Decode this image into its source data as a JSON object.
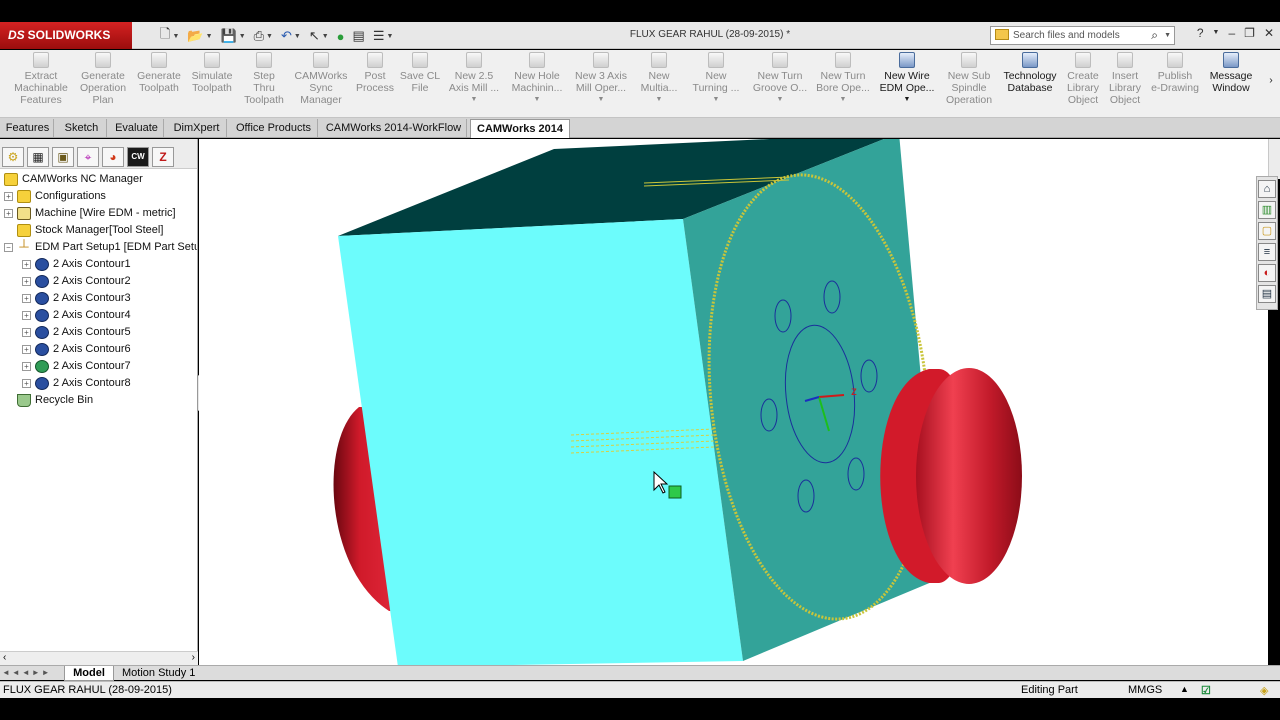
{
  "app": {
    "name": "SOLIDWORKS",
    "brand": "DS",
    "brand_color": "#c21a1a"
  },
  "document_title": "FLUX GEAR RAHUL (28-09-2015) *",
  "search": {
    "placeholder": "Search files and models"
  },
  "commands": [
    {
      "label_1": "Extract",
      "label_2": "Machinable",
      "label_3": "Features",
      "enabled": false
    },
    {
      "label_1": "Generate",
      "label_2": "Operation",
      "label_3": "Plan",
      "enabled": false
    },
    {
      "label_1": "Generate",
      "label_2": "Toolpath",
      "label_3": "",
      "enabled": false
    },
    {
      "label_1": "Simulate",
      "label_2": "Toolpath",
      "label_3": "",
      "enabled": false
    },
    {
      "label_1": "Step",
      "label_2": "Thru",
      "label_3": "Toolpath",
      "enabled": false
    },
    {
      "label_1": "CAMWorks",
      "label_2": "Sync",
      "label_3": "Manager",
      "enabled": false
    },
    {
      "label_1": "Post",
      "label_2": "Process",
      "label_3": "",
      "enabled": false
    },
    {
      "label_1": "Save CL",
      "label_2": "File",
      "label_3": "",
      "enabled": false
    },
    {
      "label_1": "New 2.5",
      "label_2": "Axis Mill ...",
      "label_3": "",
      "enabled": false
    },
    {
      "label_1": "New Hole",
      "label_2": "Machinin...",
      "label_3": "",
      "enabled": false
    },
    {
      "label_1": "New 3 Axis",
      "label_2": "Mill Oper...",
      "label_3": "",
      "enabled": false
    },
    {
      "label_1": "New",
      "label_2": "Multia...",
      "label_3": "",
      "enabled": false
    },
    {
      "label_1": "New",
      "label_2": "Turning ...",
      "label_3": "",
      "enabled": false
    },
    {
      "label_1": "New Turn",
      "label_2": "Groove O...",
      "label_3": "",
      "enabled": false
    },
    {
      "label_1": "New Turn",
      "label_2": "Bore Ope...",
      "label_3": "",
      "enabled": false
    },
    {
      "label_1": "New Wire",
      "label_2": "EDM Ope...",
      "label_3": "",
      "enabled": true
    },
    {
      "label_1": "New Sub",
      "label_2": "Spindle",
      "label_3": "Operation",
      "enabled": false
    },
    {
      "label_1": "Technology",
      "label_2": "Database",
      "label_3": "",
      "enabled": true
    },
    {
      "label_1": "Create",
      "label_2": "Library",
      "label_3": "Object",
      "enabled": false
    },
    {
      "label_1": "Insert",
      "label_2": "Library",
      "label_3": "Object",
      "enabled": false
    },
    {
      "label_1": "Publish",
      "label_2": "e-Drawing",
      "label_3": "",
      "enabled": false
    },
    {
      "label_1": "Message",
      "label_2": "Window",
      "label_3": "",
      "enabled": true
    }
  ],
  "tabs": [
    "Features",
    "Sketch",
    "Evaluate",
    "DimXpert",
    "Office Products",
    "CAMWorks 2014-WorkFlow",
    "CAMWorks 2014"
  ],
  "active_tab": "CAMWorks 2014",
  "tree": {
    "root": "CAMWorks NC Manager",
    "configurations": "Configurations",
    "machine": "Machine [Wire EDM - metric]",
    "stock": "Stock Manager[Tool Steel]",
    "setup": "EDM Part Setup1 [EDM Part Setu",
    "operations": [
      "2 Axis Contour1",
      "2 Axis Contour2",
      "2 Axis Contour3",
      "2 Axis Contour4",
      "2 Axis Contour5",
      "2 Axis Contour6",
      "2 Axis Contour7",
      "2 Axis Contour8"
    ],
    "recycle": "Recycle Bin"
  },
  "bottom_tabs": [
    "Model",
    "Motion Study 1"
  ],
  "status": {
    "document": "FLUX GEAR RAHUL (28-09-2015)",
    "mode": "Editing Part",
    "units": "MMGS"
  },
  "colors": {
    "front_face": "#6cfcfc",
    "side_face": "#33a399",
    "top_face": "#003f3f",
    "cylinder": "#b0101e",
    "gear_outline": "#c9c53a"
  },
  "icons": [
    "new-document-icon",
    "open-folder-icon",
    "save-icon",
    "print-icon",
    "undo-icon",
    "select-cursor-icon",
    "traffic-light-icon",
    "options-icon",
    "search-icon",
    "help-icon",
    "minimize-icon",
    "restore-icon",
    "close-icon"
  ]
}
